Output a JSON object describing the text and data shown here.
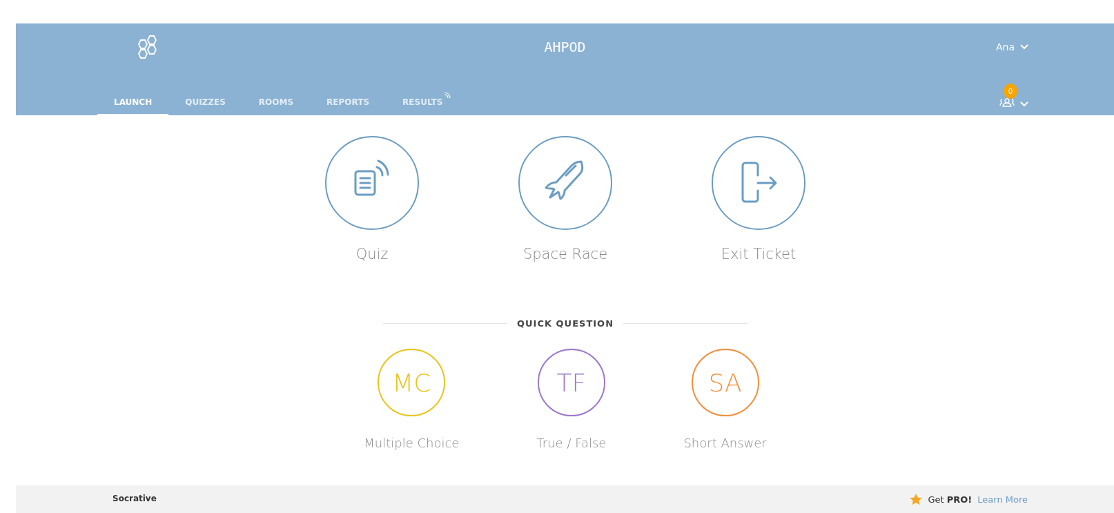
{
  "header": {
    "title": "AHPOD",
    "user": "Ana",
    "rooms_badge": "0"
  },
  "tabs": [
    {
      "label": "LAUNCH",
      "selected": true,
      "live": false
    },
    {
      "label": "QUIZZES",
      "selected": false,
      "live": false
    },
    {
      "label": "ROOMS",
      "selected": false,
      "live": false
    },
    {
      "label": "REPORTS",
      "selected": false,
      "live": false
    },
    {
      "label": "RESULTS",
      "selected": false,
      "live": true
    }
  ],
  "activities": [
    {
      "kind": "quiz",
      "label": "Quiz"
    },
    {
      "kind": "rocket",
      "label": "Space Race"
    },
    {
      "kind": "exit",
      "label": "Exit Ticket"
    }
  ],
  "quick_question": {
    "heading": "QUICK QUESTION",
    "items": [
      {
        "abbr": "MC",
        "label": "Multiple Choice",
        "color": "#e8c51f"
      },
      {
        "abbr": "TF",
        "label": "True / False",
        "color": "#9b78cc"
      },
      {
        "abbr": "SA",
        "label": "Short Answer",
        "color": "#f28f3b"
      }
    ]
  },
  "footer": {
    "brand": "Socrative",
    "pro": "Get **PRO!**",
    "link": "Learn More"
  }
}
